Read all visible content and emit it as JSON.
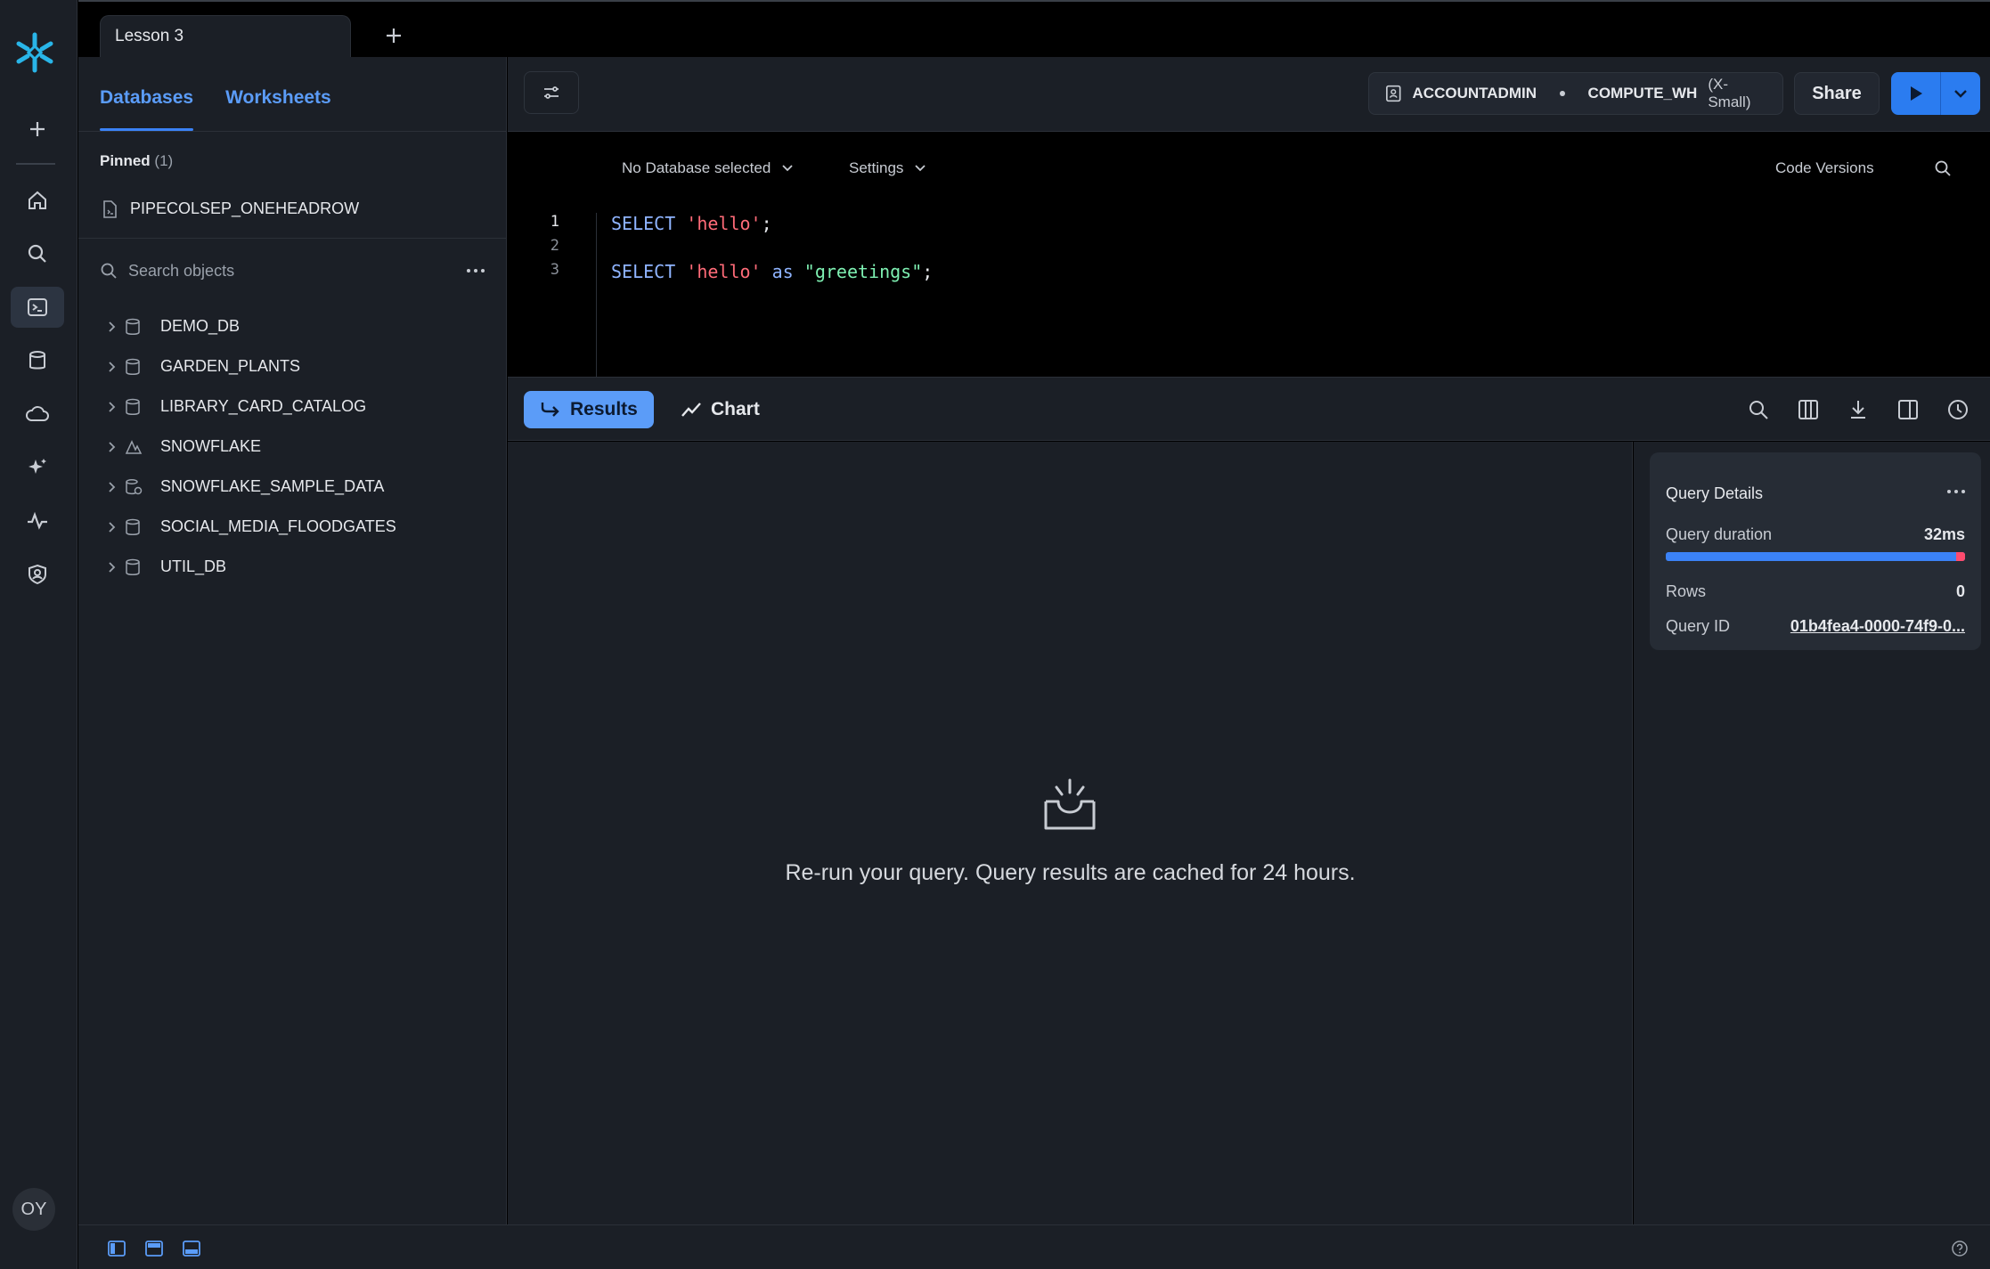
{
  "tabs": [
    {
      "label": "Lesson 3"
    }
  ],
  "browser": {
    "tabs": [
      {
        "label": "Databases"
      },
      {
        "label": "Worksheets"
      }
    ],
    "pinned_label": "Pinned",
    "pinned_count": "(1)",
    "pinned_item": "PIPECOLSEP_ONEHEADROW",
    "search_placeholder": "Search objects",
    "databases": [
      {
        "name": "DEMO_DB",
        "icon": "database-icon"
      },
      {
        "name": "GARDEN_PLANTS",
        "icon": "database-icon"
      },
      {
        "name": "LIBRARY_CARD_CATALOG",
        "icon": "database-icon"
      },
      {
        "name": "SNOWFLAKE",
        "icon": "shared-database-icon"
      },
      {
        "name": "SNOWFLAKE_SAMPLE_DATA",
        "icon": "shared-database-icon"
      },
      {
        "name": "SOCIAL_MEDIA_FLOODGATES",
        "icon": "database-icon"
      },
      {
        "name": "UTIL_DB",
        "icon": "database-icon"
      }
    ]
  },
  "header": {
    "role": "ACCOUNTADMIN",
    "warehouse": "COMPUTE_WH",
    "warehouse_size": "(X-Small)",
    "share_label": "Share"
  },
  "editor": {
    "database_selector": "No Database selected",
    "settings_label": "Settings",
    "code_versions_label": "Code Versions",
    "line_numbers": [
      "1",
      "2",
      "3"
    ],
    "lines": [
      {
        "kw": "SELECT",
        "str": "'hello'",
        "end": ";"
      },
      {},
      {
        "kw": "SELECT",
        "str": "'hello'",
        "kw2": "as",
        "qid": "\"greetings\"",
        "end": ";"
      }
    ]
  },
  "results": {
    "results_label": "Results",
    "chart_label": "Chart",
    "empty_message": "Re-run your query. Query results are cached for 24 hours."
  },
  "query_details": {
    "title": "Query Details",
    "duration_label": "Query duration",
    "duration_value": "32ms",
    "rows_label": "Rows",
    "rows_value": "0",
    "query_id_label": "Query ID",
    "query_id_value": "01b4fea4-0000-74f9-0..."
  },
  "user": {
    "initials": "OY"
  },
  "colors": {
    "accent": "#2b7cf0",
    "tab_link": "#5b9cf8",
    "keyword": "#8fb4ff",
    "string": "#ff6b78",
    "identifier": "#7ef0b2"
  }
}
